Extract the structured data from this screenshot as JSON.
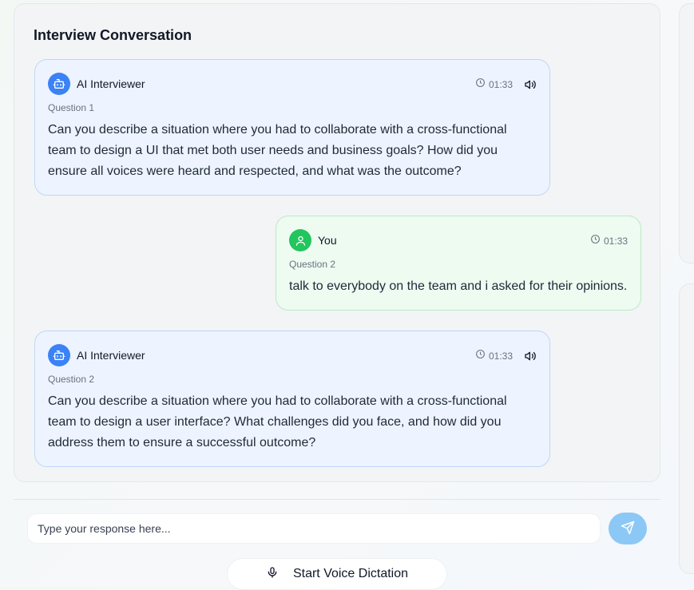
{
  "conversation": {
    "title": "Interview Conversation",
    "messages": [
      {
        "role": "ai",
        "sender": "AI Interviewer",
        "time": "01:33",
        "question_label": "Question 1",
        "text": "Can you describe a situation where you had to collaborate with a cross-functional team to design a UI that met both user needs and business goals? How did you ensure all voices were heard and respected, and what was the outcome?"
      },
      {
        "role": "user",
        "sender": "You",
        "time": "01:33",
        "question_label": "Question 2",
        "text": "talk to everybody on the team and i asked for their opinions."
      },
      {
        "role": "ai",
        "sender": "AI Interviewer",
        "time": "01:33",
        "question_label": "Question 2",
        "text": "Can you describe a situation where you had to collaborate with a cross-functional team to design a user interface? What challenges did you face, and how did you address them to ensure a successful outcome?"
      }
    ]
  },
  "composer": {
    "placeholder": "Type your response here...",
    "value": "",
    "send_icon": "send-icon"
  },
  "voice": {
    "label": "Start Voice Dictation",
    "icon": "microphone-icon"
  },
  "colors": {
    "ai_bubble": "#edf4ff",
    "user_bubble": "#edfbf1",
    "ai_avatar": "#3b82f6",
    "user_avatar": "#22c55e",
    "send_button": "#8cc8f5"
  }
}
